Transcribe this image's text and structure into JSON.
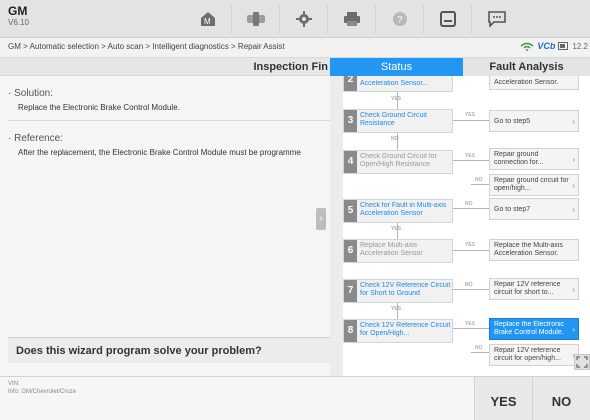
{
  "app": {
    "name": "GM",
    "version": "V6.10"
  },
  "toolbar": {
    "icons": [
      "home-icon",
      "vci-connect-icon",
      "settings-icon",
      "print-icon",
      "help-icon",
      "save-icon",
      "message-icon"
    ]
  },
  "breadcrumb": "GM > Automatic selection > Auto scan > Intelligent diagnostics > Repair Assist",
  "status_bar": {
    "vci_label": "VCb",
    "time": "12.2"
  },
  "page": {
    "title": "Inspection Fin",
    "solution_heading": "Solution:",
    "solution_text": "Replace the Electronic Brake Control Module.",
    "reference_heading": "Reference:",
    "reference_text": "After the replacement, the Electronic Brake Control Module must be programme",
    "question": "Does this wizard program solve your problem?"
  },
  "tabs": {
    "status": "Status",
    "fault_analysis": "Fault Analysis"
  },
  "flow": {
    "step2": "Acceleration Sensor...",
    "step2_result": "Acceleration Sensor.",
    "step3": "Check Ground Circuit Resistance",
    "step3_result": "Go to step5",
    "step4": "Check Ground Circuit for Open/High Resistance",
    "step4_result_yes": "Repair ground connection for...",
    "step4_result_no": "Repair ground circuit for open/high...",
    "step5": "Check for Fault in Multi-axis Acceleration Sensor",
    "step5_result": "Go to step7",
    "step6": "Replace Multi-axis Acceleration Sensor",
    "step6_result": "Replace the Multi-axis Acceleration Sensor.",
    "step7": "Check 12V Reference Circuit for Short to Ground",
    "step7_result": "Repair 12V reference circuit for short to...",
    "step8": "Check 12V Reference Circuit for Open/High...",
    "step8_result_yes": "Replace the Electronic Brake Control Module.",
    "step8_result_no": "Repair 12V reference circuit for open/high...",
    "yes": "YES",
    "no": "NO"
  },
  "footer": {
    "vin_label": "VIN:",
    "info": "Info: GM/Chevrolet/Cruze",
    "yes_button": "YES",
    "no_button": "NO"
  },
  "colors": {
    "accent": "#2196f3",
    "ok_green": "#3a9b3f"
  }
}
